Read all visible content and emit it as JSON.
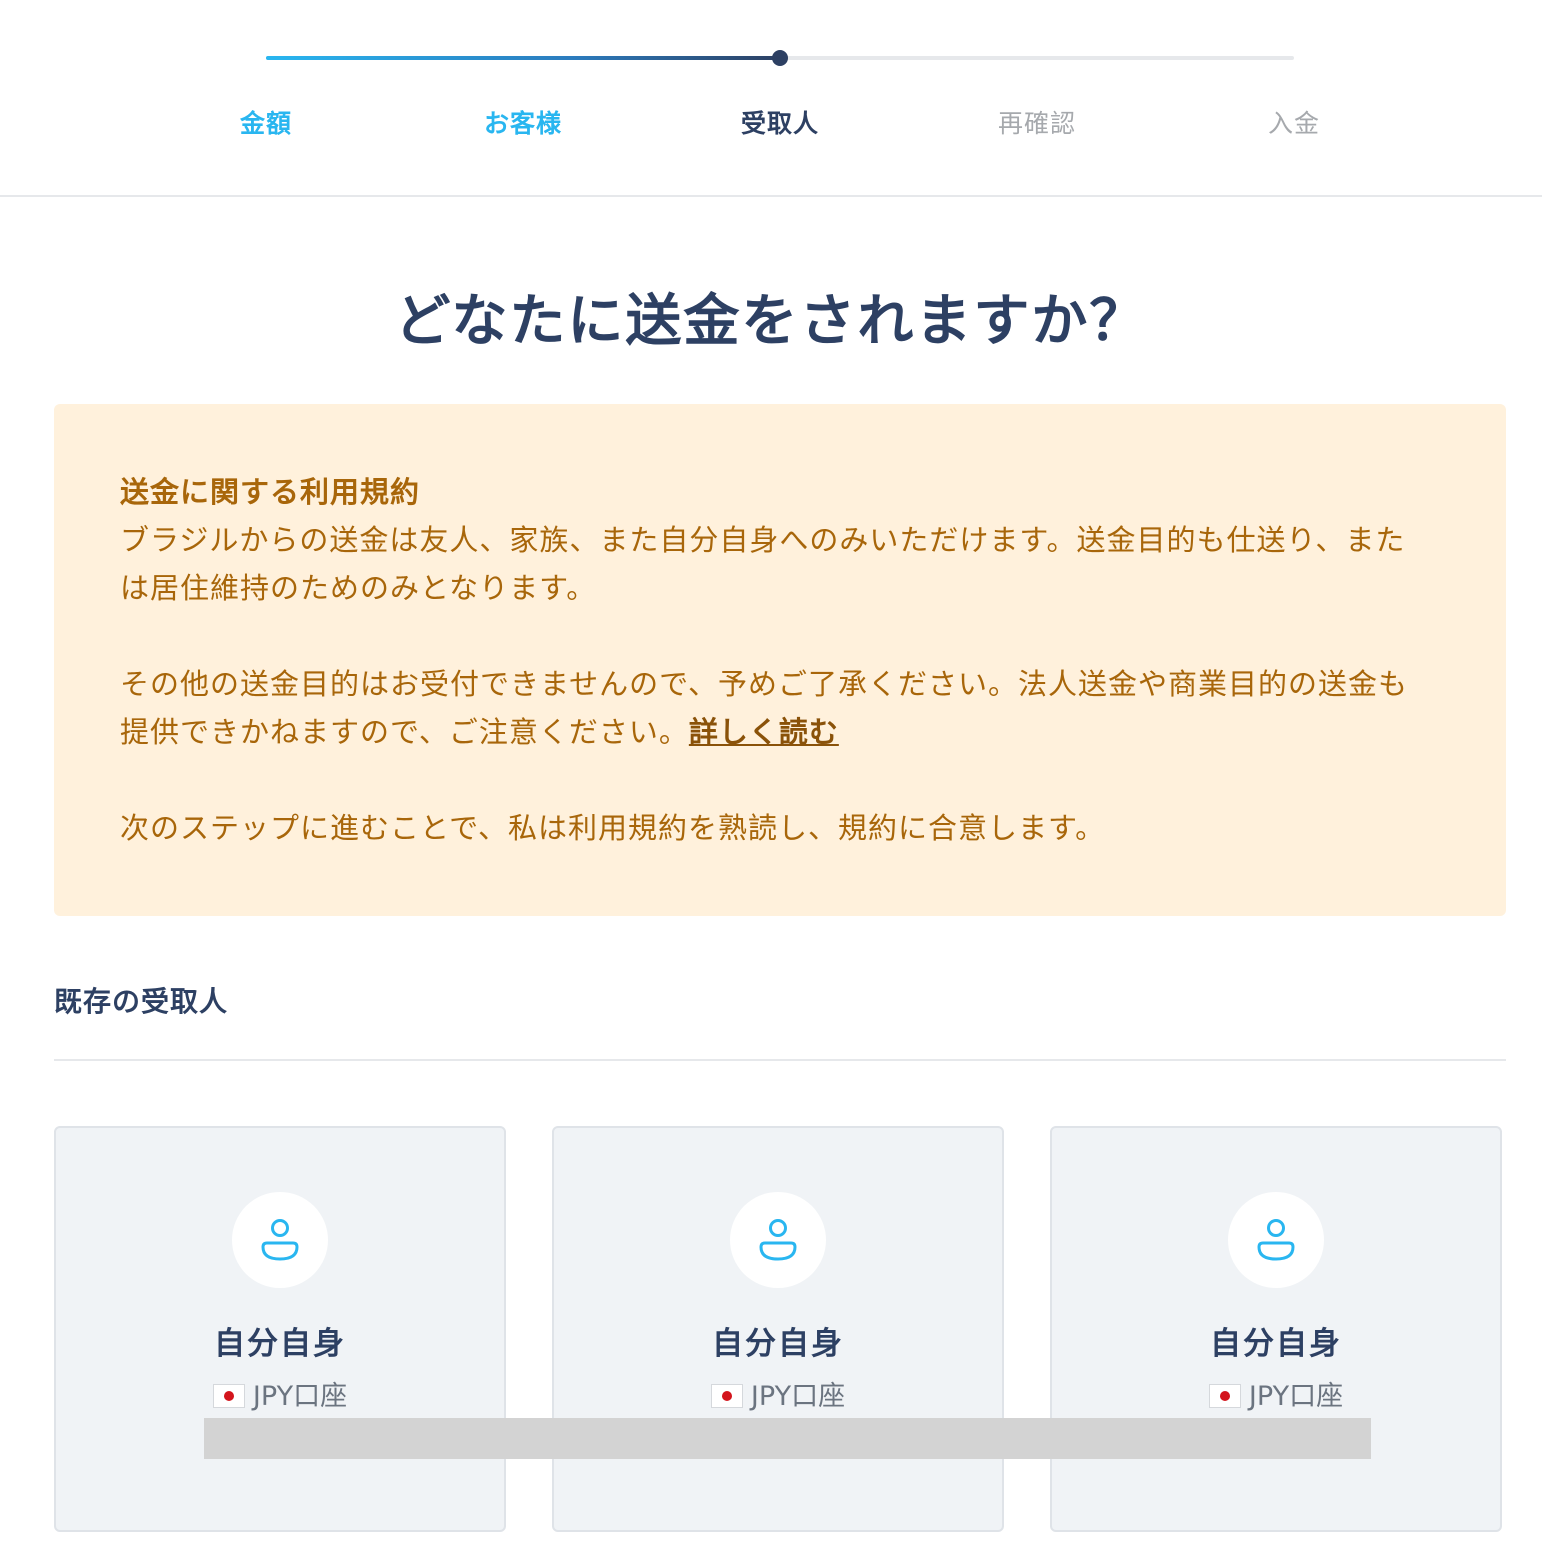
{
  "stepper": {
    "progress": 0.5,
    "steps": [
      {
        "label": "金額",
        "state": "done"
      },
      {
        "label": "お客様",
        "state": "done"
      },
      {
        "label": "受取人",
        "state": "current"
      },
      {
        "label": "再確認",
        "state": "todo"
      },
      {
        "label": "入金",
        "state": "todo"
      }
    ]
  },
  "title": "どなたに送金をされますか？",
  "notice": {
    "heading": "送金に関する利用規約",
    "para1": "ブラジルからの送金は友人、家族、また自分自身へのみいただけます。送金目的も仕送り、または居住維持のためのみとなります。",
    "para2": "その他の送金目的はお受付できませんので、予めご了承ください。法人送金や商業目的の送金も提供できかねますので、ご注意ください。",
    "link": "詳しく読む",
    "para3": "次のステップに進むことで、私は利用規約を熟読し、規約に合意します。"
  },
  "section": {
    "title": "既存の受取人"
  },
  "recipients": [
    {
      "name": "自分自身",
      "account": "JPY口座",
      "flag": "japan-flag-icon",
      "icon": "user-icon"
    },
    {
      "name": "自分自身",
      "account": "JPY口座",
      "flag": "japan-flag-icon",
      "icon": "user-icon"
    },
    {
      "name": "自分自身",
      "account": "JPY口座",
      "flag": "japan-flag-icon",
      "icon": "user-icon"
    }
  ],
  "colors": {
    "primary_dark": "#2d4063",
    "accent_blue": "#29b6f0",
    "notice_bg": "#fff1dc",
    "notice_text": "#a8660a",
    "card_bg": "#f0f3f6"
  }
}
